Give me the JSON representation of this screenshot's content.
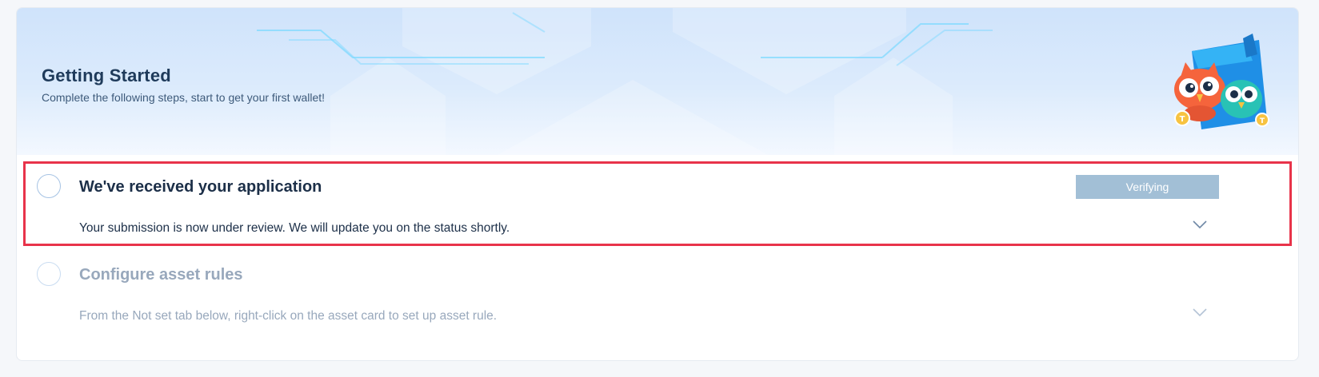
{
  "banner": {
    "title": "Getting Started",
    "subtitle": "Complete the following steps, start to get your first wallet!"
  },
  "steps": [
    {
      "title": "We've received your application",
      "description": "Your submission is now under review. We will update you on the status shortly.",
      "status_label": "Verifying",
      "highlighted": true
    },
    {
      "title": "Configure asset rules",
      "description": "From the Not set tab below, right-click on the asset card to set up asset rule.",
      "highlighted": false
    }
  ],
  "colors": {
    "highlight_border": "#e8334a",
    "status_button": "#a2bfd6",
    "title_dark": "#1c2f48",
    "muted_text": "#98a8bc",
    "banner_bg": "#cfe3fb"
  },
  "icons": {
    "mascot": "owl-wallet-mascot",
    "step_marker": "step-circle-icon",
    "expand": "chevron-down-icon"
  }
}
